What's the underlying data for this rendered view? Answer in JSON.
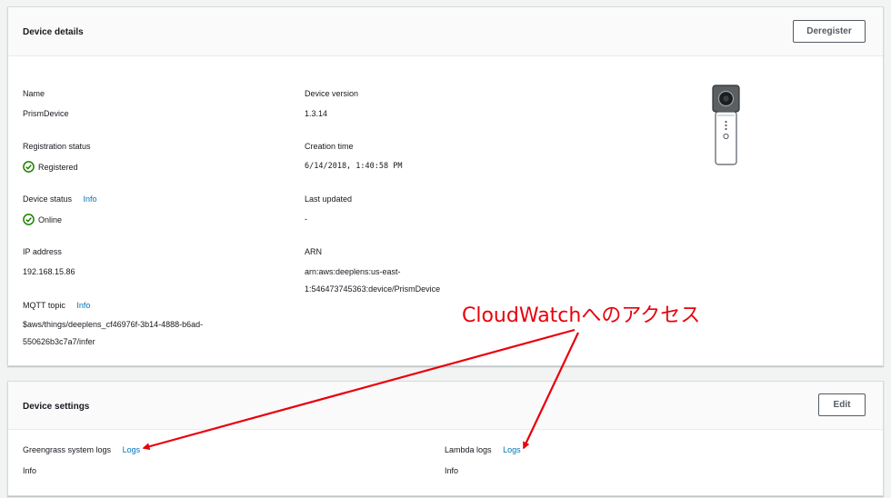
{
  "device_details": {
    "title": "Device details",
    "deregister_label": "Deregister",
    "name_label": "Name",
    "name_value": "PrismDevice",
    "registration_label": "Registration status",
    "registration_value": "Registered",
    "device_status_label": "Device status",
    "device_status_info": "Info",
    "device_status_value": "Online",
    "ip_label": "IP address",
    "ip_value": "192.168.15.86",
    "mqtt_label": "MQTT topic",
    "mqtt_info": "Info",
    "mqtt_value_line1": "$aws/things/deeplens_cf46976f-3b14-4888-b6ad-",
    "mqtt_value_line2": "550626b3c7a7/infer",
    "version_label": "Device version",
    "version_value": "1.3.14",
    "creation_label": "Creation time",
    "creation_value": "6/14/2018, 1:40:58 PM",
    "updated_label": "Last updated",
    "updated_value": "-",
    "arn_label": "ARN",
    "arn_value_line1": "arn:aws:deeplens:us-east-",
    "arn_value_line2": "1:546473745363:device/PrismDevice",
    "image_icon": "deeplens-camera-icon"
  },
  "device_settings": {
    "title": "Device settings",
    "edit_label": "Edit",
    "greengrass_label": "Greengrass system logs",
    "greengrass_link": "Logs",
    "greengrass_value": "Info",
    "lambda_label": "Lambda logs",
    "lambda_link": "Logs",
    "lambda_value": "Info"
  },
  "annotation": {
    "text": "CloudWatchへのアクセス",
    "color": "#e8000b"
  },
  "colors": {
    "success": "#1d8102",
    "link": "#0073bb"
  }
}
